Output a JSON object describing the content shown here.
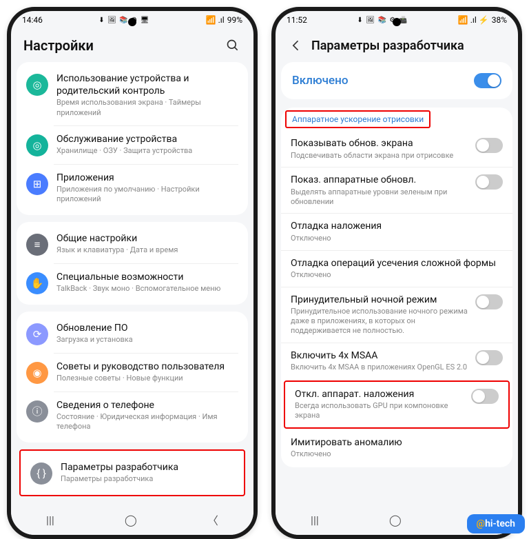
{
  "phone1": {
    "status": {
      "time": "14:46",
      "icons": "⬇ 🖼 📚 ⚙ 🖥",
      "battery": "99%",
      "signal": "📶 .ıl"
    },
    "title": "Настройки",
    "groups": [
      {
        "items": [
          {
            "icon": "◎",
            "bg": "#1bb89a",
            "title": "Использование устройства и родительский контроль",
            "desc": "Время использования экрана · Таймеры приложений"
          },
          {
            "icon": "◎",
            "bg": "#14b39b",
            "title": "Обслуживание устройства",
            "desc": "Хранилище · ОЗУ · Защита устройства"
          },
          {
            "icon": "⊞",
            "bg": "#4a7cff",
            "title": "Приложения",
            "desc": "Приложения по умолчанию · Настройки приложений"
          }
        ]
      },
      {
        "items": [
          {
            "icon": "≡",
            "bg": "#6a6e78",
            "title": "Общие настройки",
            "desc": "Язык и клавиатура · Дата и время"
          },
          {
            "icon": "✋",
            "bg": "#3a8dff",
            "title": "Специальные возможности",
            "desc": "TalkBack · Звук моно · Вспомогательное меню"
          }
        ]
      },
      {
        "items": [
          {
            "icon": "⟳",
            "bg": "#8c99ff",
            "title": "Обновление ПО",
            "desc": "Загрузка и установка"
          },
          {
            "icon": "◉",
            "bg": "#ff9843",
            "title": "Советы и руководство пользователя",
            "desc": "Полезные советы · Новые функции"
          },
          {
            "icon": "ⓘ",
            "bg": "#8a8f99",
            "title": "Сведения о телефоне",
            "desc": "Состояние · Юридическая информация · Имя телефона"
          }
        ]
      },
      {
        "highlight": true,
        "items": [
          {
            "icon": "{ }",
            "bg": "#8a8f99",
            "title": "Параметры разработчика",
            "desc": "Параметры разработчика"
          }
        ]
      }
    ]
  },
  "phone2": {
    "status": {
      "time": "11:52",
      "icons": "⬇ 🖼 📚 ⚙ 📠",
      "battery": "38%",
      "signal": "📶 .ıl ⚡"
    },
    "title": "Параметры разработчика",
    "enabled": "Включено",
    "section": "Аппаратное ускорение отрисовки",
    "opts": [
      {
        "t": "Показывать обнов. экрана",
        "d": "Подсвечивать области экрана при отрисовке",
        "toggle": false
      },
      {
        "t": "Показ. аппаратные обновл.",
        "d": "Выделять аппаратные уровни зеленым при обновлении",
        "toggle": false
      },
      {
        "t": "Отладка наложения",
        "d": "Отключено"
      },
      {
        "t": "Отладка операций усечения сложной формы",
        "d": "Отключено"
      },
      {
        "t": "Принудительный ночной режим",
        "d": "Принудительное использование ночного режима даже в приложениях, в которых он поддерживается не полностью.",
        "toggle": false
      },
      {
        "t": "Включить 4x MSAA",
        "d": "Включить 4x MSAA в приложениях OpenGL ES 2.0",
        "toggle": false
      },
      {
        "t": "Откл. аппарат. наложения",
        "d": "Всегда использовать GPU при компоновке экрана",
        "toggle": false,
        "highlight": true
      },
      {
        "t": "Имитировать аномалию",
        "d": "Отключено"
      }
    ]
  },
  "watermark": "hi-tech"
}
